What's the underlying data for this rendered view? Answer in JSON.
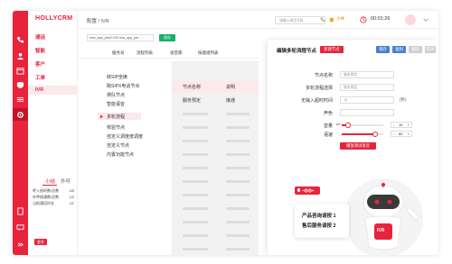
{
  "app": {
    "brand": "HOLLYCRM"
  },
  "nav": {
    "items": [
      "通话",
      "智能",
      "客户",
      "工单",
      "IVR"
    ]
  },
  "stats": {
    "title_active": "小结",
    "title_other": "外呼",
    "rows": [
      {
        "label": "呼入接听数/总数",
        "value": "4/5"
      },
      {
        "label": "外呼接通数/总数",
        "value": "1/2"
      },
      {
        "label": "当前通话时长",
        "value": "10'"
      }
    ],
    "more_label": "更多"
  },
  "topbar": {
    "breadcrumb": "配置 / IVR",
    "search_placeholder": "请输入电话号码",
    "status_text": "小休",
    "timer": "00:01:26"
  },
  "toolbar": {
    "url_text": "new_app_ptet2.100 new_app_pte...",
    "save_label": "保存"
  },
  "tabs": [
    "服务号",
    "流程列表",
    "语音库",
    "技能组列表"
  ],
  "tree": {
    "items": [
      "转SIP坐席",
      "跨SIPX电话节点",
      "排队节点",
      "智能语音",
      "多轮流程",
      "校验节点",
      "自定义调度度调度",
      "自定义节点",
      "内置功能节点"
    ],
    "selected_index": 4
  },
  "table": {
    "columns": [
      "节点名称",
      "说明"
    ],
    "first_row": [
      "服务预定",
      "接通"
    ]
  },
  "panel": {
    "title": "编辑多轮流程节点",
    "create_label": "新建节点",
    "actions": [
      {
        "label": "保存",
        "color": "#4a7fd6"
      },
      {
        "label": "复制",
        "color": "#4a7fd6"
      },
      {
        "label": "删除",
        "color": "#cfcfcf"
      },
      {
        "label": "取消",
        "color": "#cfcfcf"
      }
    ],
    "fields": [
      {
        "label": "节点名称",
        "value": "服务预定"
      },
      {
        "label": "多轮流程选择",
        "value": "服务预定"
      },
      {
        "label": "无输入超时时间",
        "value": "10",
        "unit": "(秒)"
      },
      {
        "label": "声色",
        "value": ""
      }
    ],
    "volume": {
      "label": "音量",
      "value": "15",
      "level": 0.15
    },
    "speed": {
      "label": "语速",
      "value": "80",
      "level": 0.8
    },
    "test_label": "播放测试语音"
  },
  "illustration": {
    "lines": [
      "产品咨询请按 1",
      "售后服务请按 2"
    ],
    "badge": "IVR"
  },
  "colors": {
    "primary": "#e8233c",
    "accent_blue": "#4a7fd6",
    "success": "#19b06b"
  }
}
